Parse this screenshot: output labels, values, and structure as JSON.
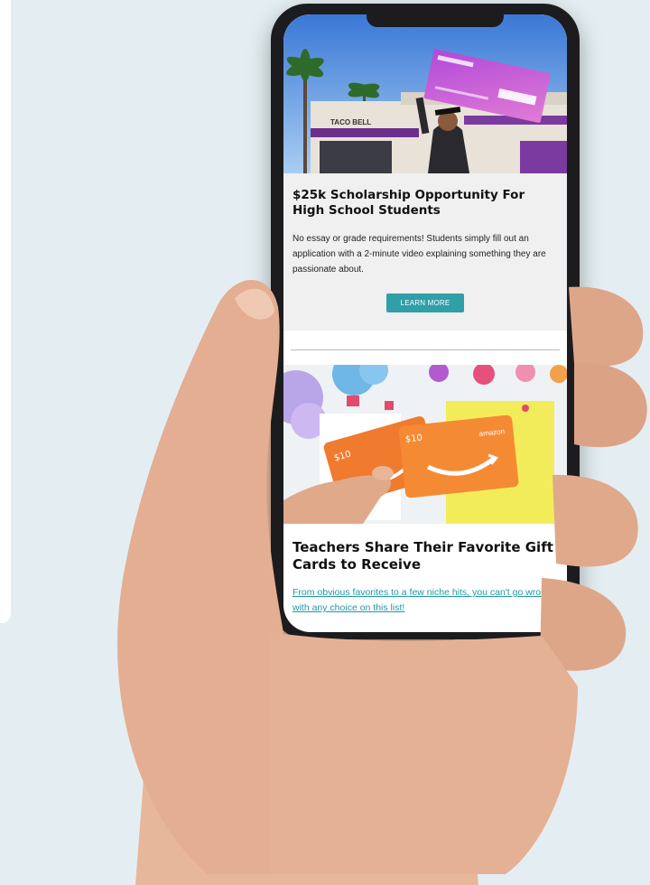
{
  "article1": {
    "title": "$25k Scholarship Opportunity For High School Students",
    "description": "No essay or grade requirements! Students simply fill out an application with a 2-minute video explaining something they are passionate about.",
    "button_label": "LEARN MORE",
    "photo_sign": "TACO BELL"
  },
  "article2": {
    "title": "Teachers Share Their Favorite Gift Cards to Receive",
    "link_text": "From obvious favorites to a few niche hits, you can't go wrong with any choice on this list!",
    "card_amount": "$10",
    "card_brand": "amazon"
  },
  "colors": {
    "button": "#2f9fa8",
    "link": "#1f9aa3",
    "background": "#e4eef2",
    "gift_card": "#f07a2e"
  }
}
